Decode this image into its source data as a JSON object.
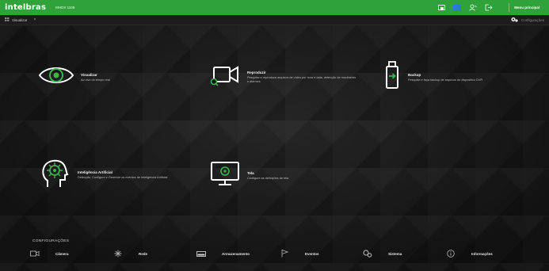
{
  "app": {
    "brand": "intelbras",
    "model": "MHDX 1108"
  },
  "header": {
    "main_menu": "Menu principal"
  },
  "tabbar": {
    "tab_label": "Visualizar",
    "settings_label": "Configurações"
  },
  "colors": {
    "accent": "#2fa23a",
    "icon_green": "#39b54a",
    "cloud_blue": "#2a7bd6"
  },
  "modules": [
    {
      "id": "visualizar",
      "title": "Visualizar",
      "desc": "Ao vivo do tempo real",
      "icon": "eye-icon"
    },
    {
      "id": "reproduzir",
      "title": "Reproduzir",
      "desc": "Pesquise e reproduza arquivos de vídeo por hora e data, detecção de movimento e alarmes",
      "icon": "video-camera-icon"
    },
    {
      "id": "backup",
      "title": "Backup",
      "desc": "Pesquise e faça backup de arquivos do dispositivo DVR",
      "icon": "usb-drive-icon"
    },
    {
      "id": "inteligencia",
      "title": "Inteligência Artificial",
      "desc": "Detecção, Configure e Gerencie os eventos de Inteligência Artificial",
      "icon": "ai-head-icon"
    },
    {
      "id": "tela",
      "title": "Tela",
      "desc": "Configure as definições de tela",
      "icon": "monitor-icon"
    }
  ],
  "config": {
    "title": "CONFIGURAÇÕES",
    "items": [
      {
        "label": "Câmera",
        "icon": "camera-icon"
      },
      {
        "label": "Rede",
        "icon": "network-icon"
      },
      {
        "label": "Armazenamento",
        "icon": "storage-icon"
      },
      {
        "label": "Eventos",
        "icon": "event-flag-icon"
      },
      {
        "label": "Sistema",
        "icon": "system-icon"
      },
      {
        "label": "Informações",
        "icon": "info-icon"
      }
    ]
  }
}
